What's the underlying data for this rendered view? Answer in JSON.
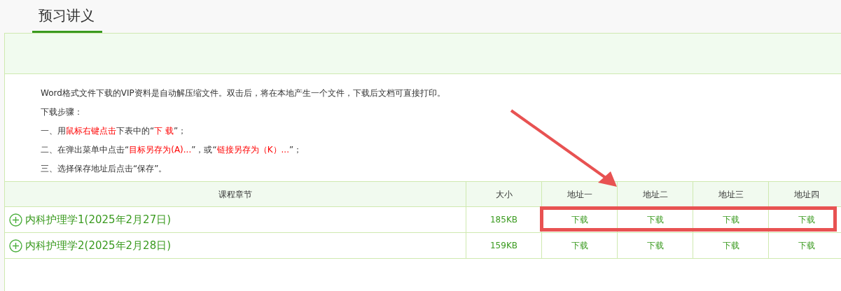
{
  "tab": {
    "label": "预习讲义",
    "selected": true
  },
  "instructions": [
    [
      {
        "text": "Word格式文件下载的VIP资料是自动解压缩文件。双击后，将在本地产生一个文件，下载后文档可直接打印。",
        "red": false
      }
    ],
    [
      {
        "text": "下载步骤：",
        "red": false
      }
    ],
    [
      {
        "text": "一、用",
        "red": false
      },
      {
        "text": "鼠标右键点击",
        "red": true
      },
      {
        "text": "下表中的“",
        "red": false
      },
      {
        "text": "下 载",
        "red": true
      },
      {
        "text": "”；",
        "red": false
      }
    ],
    [
      {
        "text": "二、在弹出菜单中点击“",
        "red": false
      },
      {
        "text": "目标另存为(A)...",
        "red": true
      },
      {
        "text": "”，或“",
        "red": false
      },
      {
        "text": "链接另存为（K）...",
        "red": true
      },
      {
        "text": "”；",
        "red": false
      }
    ],
    [
      {
        "text": "三、选择保存地址后点击“保存”。",
        "red": false
      }
    ]
  ],
  "table": {
    "columns": [
      "课程章节",
      "大小",
      "地址一",
      "地址二",
      "地址三",
      "地址四"
    ],
    "rows": [
      {
        "chapter": "内科护理学1(2025年2月27日)",
        "size": "185KB",
        "links": [
          "下载",
          "下载",
          "下载",
          "下载"
        ],
        "highlighted": true
      },
      {
        "chapter": "内科护理学2(2025年2月28日)",
        "size": "159KB",
        "links": [
          "下载",
          "下载",
          "下载",
          "下载"
        ],
        "highlighted": false
      }
    ]
  }
}
